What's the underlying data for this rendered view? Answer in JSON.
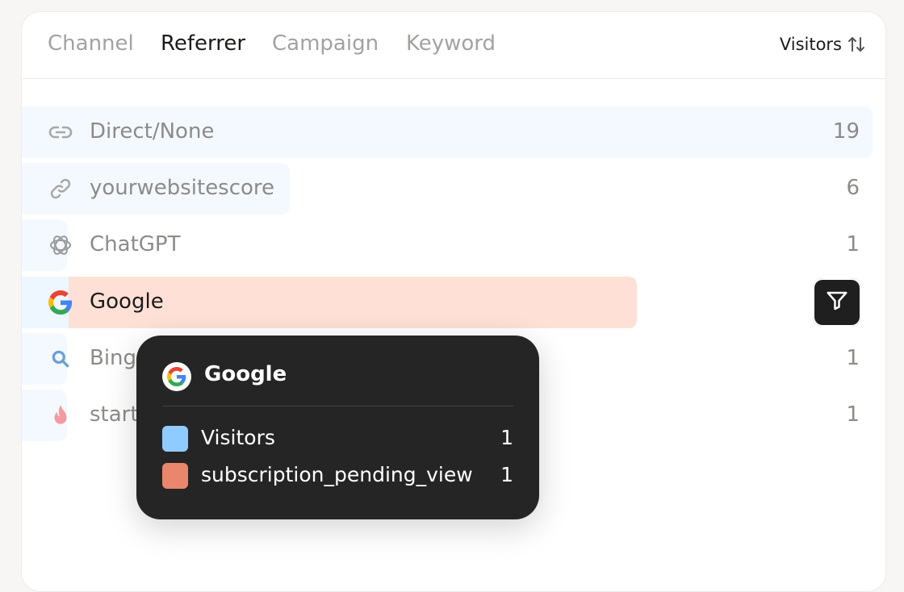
{
  "tabs": [
    {
      "label": "Channel",
      "active": false
    },
    {
      "label": "Referrer",
      "active": true
    },
    {
      "label": "Campaign",
      "active": false
    },
    {
      "label": "Keyword",
      "active": false
    }
  ],
  "sort": {
    "label": "Visitors",
    "icon": "sort-arrows-icon"
  },
  "rows": [
    {
      "label": "Direct/None",
      "value": "19",
      "icon": "link-icon"
    },
    {
      "label": "yourwebsitescore",
      "value": "6",
      "icon": "link-icon"
    },
    {
      "label": "ChatGPT",
      "value": "1",
      "icon": "openai-icon"
    },
    {
      "label": "Google",
      "value": "",
      "icon": "google-icon"
    },
    {
      "label": "Bing",
      "value": "1",
      "icon": "search-icon"
    },
    {
      "label": "start",
      "value": "1",
      "icon": "flame-icon"
    }
  ],
  "filter_button": {
    "icon": "filter-icon"
  },
  "tooltip": {
    "title": "Google",
    "items": [
      {
        "label": "Visitors",
        "value": "1",
        "color": "#8fcbff"
      },
      {
        "label": "subscription_pending_view",
        "value": "1",
        "color": "#e9866b"
      }
    ]
  },
  "colors": {
    "bar_light": "#f4f9ff",
    "bar_hover": "#ffe0d6",
    "tooltip_bg": "#252525"
  }
}
